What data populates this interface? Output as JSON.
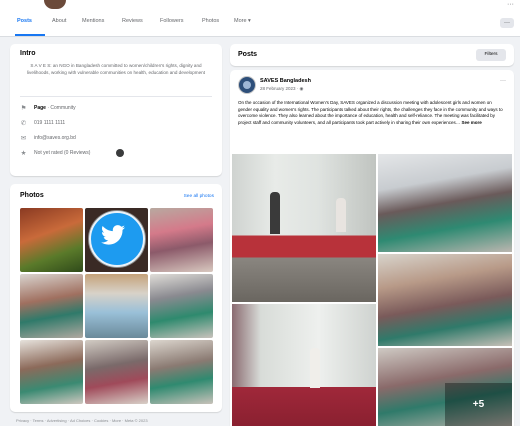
{
  "tabs": [
    {
      "label": "Posts"
    },
    {
      "label": "About"
    },
    {
      "label": "Mentions"
    },
    {
      "label": "Reviews"
    },
    {
      "label": "Followers"
    },
    {
      "label": "Photos"
    },
    {
      "label": "More ▾"
    }
  ],
  "tab_more_button": "···",
  "intro": {
    "title": "Intro",
    "bio": "S A V E S: an NGO in Bangladesh committed to women/children's rights, dignity and livelihoods, working with vulnerable communities on health, education and development",
    "rows": [
      {
        "icon": "flag-icon",
        "glyph": "⚑",
        "prefix": "Page",
        "text": " · Community"
      },
      {
        "icon": "phone-icon",
        "glyph": "✆",
        "prefix": "",
        "text": "019 1111 1111"
      },
      {
        "icon": "email-icon",
        "glyph": "✉",
        "prefix": "",
        "text": "info@saves.org.bd"
      },
      {
        "icon": "star-icon",
        "glyph": "★",
        "prefix": "",
        "text": "Not yet rated (0 Reviews)"
      }
    ]
  },
  "photos": {
    "title": "Photos",
    "see_all": "See all photos"
  },
  "footer": "Privacy · Terms · Advertising · Ad Choices · Cookies · More · Meta © 2023",
  "posts": {
    "title": "Posts",
    "filters_label": "Filters"
  },
  "post": {
    "page_name": "SAVES Bangladesh",
    "date": "28 February 2023 · ◉",
    "menu": "···",
    "text": "On the occasion of the International Women's Day, SAVES organized a discussion meeting with adolescent girls and women on gender equality and women's rights. The participants talked about their rights, the challenges they face in the community and ways to overcome violence. They also learned about the importance of education, health and self-reliance. The meeting was facilitated by project staff and community volunteers, and all participants took part actively in sharing their own experiences…",
    "see_more": "See more",
    "extra_photos": "+5"
  },
  "colors": {
    "accent": "#1877f2",
    "background": "#f0f2f5",
    "card": "#ffffff",
    "text_secondary": "#65676b"
  }
}
